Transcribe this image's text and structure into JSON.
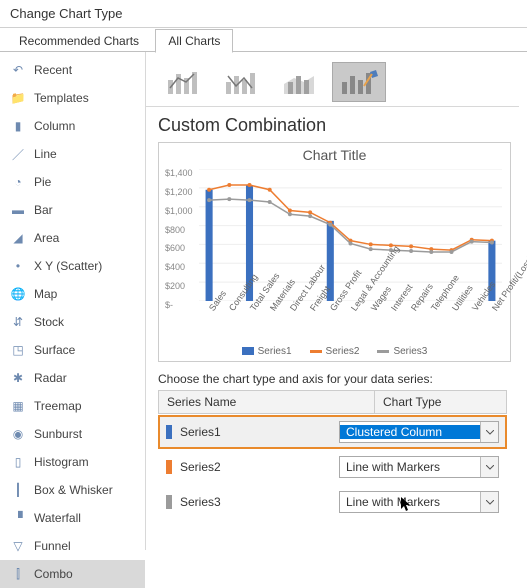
{
  "window_title": "Change Chart Type",
  "tabs": {
    "recommended": "Recommended Charts",
    "all": "All Charts",
    "active": "all"
  },
  "sidebar": {
    "items": [
      {
        "label": "Recent"
      },
      {
        "label": "Templates"
      },
      {
        "label": "Column"
      },
      {
        "label": "Line"
      },
      {
        "label": "Pie"
      },
      {
        "label": "Bar"
      },
      {
        "label": "Area"
      },
      {
        "label": "X Y (Scatter)"
      },
      {
        "label": "Map"
      },
      {
        "label": "Stock"
      },
      {
        "label": "Surface"
      },
      {
        "label": "Radar"
      },
      {
        "label": "Treemap"
      },
      {
        "label": "Sunburst"
      },
      {
        "label": "Histogram"
      },
      {
        "label": "Box & Whisker"
      },
      {
        "label": "Waterfall"
      },
      {
        "label": "Funnel"
      },
      {
        "label": "Combo"
      }
    ],
    "selected_index": 18
  },
  "subtype_name": "Custom Combination",
  "series_hint": "Choose the chart type and axis for your data series:",
  "grid": {
    "col1": "Series Name",
    "col2": "Chart Type"
  },
  "series_rows": [
    {
      "name": "Series1",
      "type": "Clustered Column",
      "color": "#3b70bf",
      "highlight": true
    },
    {
      "name": "Series2",
      "type": "Line with Markers",
      "color": "#ed7d31"
    },
    {
      "name": "Series3",
      "type": "Line with Markers",
      "color": "#9b9b9b"
    }
  ],
  "chart_data": {
    "type": "combo",
    "title": "Chart Title",
    "ylim": [
      0,
      1400
    ],
    "yticks": [
      "$1,400",
      "$1,200",
      "$1,000",
      "$800",
      "$600",
      "$400",
      "$200",
      "$-"
    ],
    "categories": [
      "Sales",
      "Consulting",
      "Total Sales",
      "Materials",
      "Direct Labour",
      "Freight",
      "Gross Profit",
      "Legal & Accounting",
      "Wages",
      "Interest",
      "Repairs",
      "Telephone",
      "Utilities",
      "Vehicles",
      "Net Profit/(Loss)"
    ],
    "series": [
      {
        "name": "Series1",
        "kind": "bar",
        "color": "#3b70bf",
        "values": [
          1180,
          0,
          1230,
          0,
          0,
          0,
          850,
          0,
          0,
          0,
          0,
          0,
          0,
          0,
          640
        ]
      },
      {
        "name": "Series2",
        "kind": "line",
        "color": "#ed7d31",
        "values": [
          1180,
          1230,
          1230,
          1180,
          960,
          940,
          830,
          640,
          600,
          590,
          580,
          550,
          540,
          650,
          640
        ]
      },
      {
        "name": "Series3",
        "kind": "line",
        "color": "#9b9b9b",
        "values": [
          1070,
          1080,
          1070,
          1050,
          920,
          900,
          810,
          610,
          550,
          540,
          530,
          520,
          520,
          630,
          620
        ]
      }
    ],
    "legend": [
      "Series1",
      "Series2",
      "Series3"
    ]
  },
  "colors": {
    "accent": "#0078d7",
    "highlight": "#e98a2c",
    "blue": "#3b70bf",
    "orange": "#ed7d31",
    "gray": "#9b9b9b"
  }
}
